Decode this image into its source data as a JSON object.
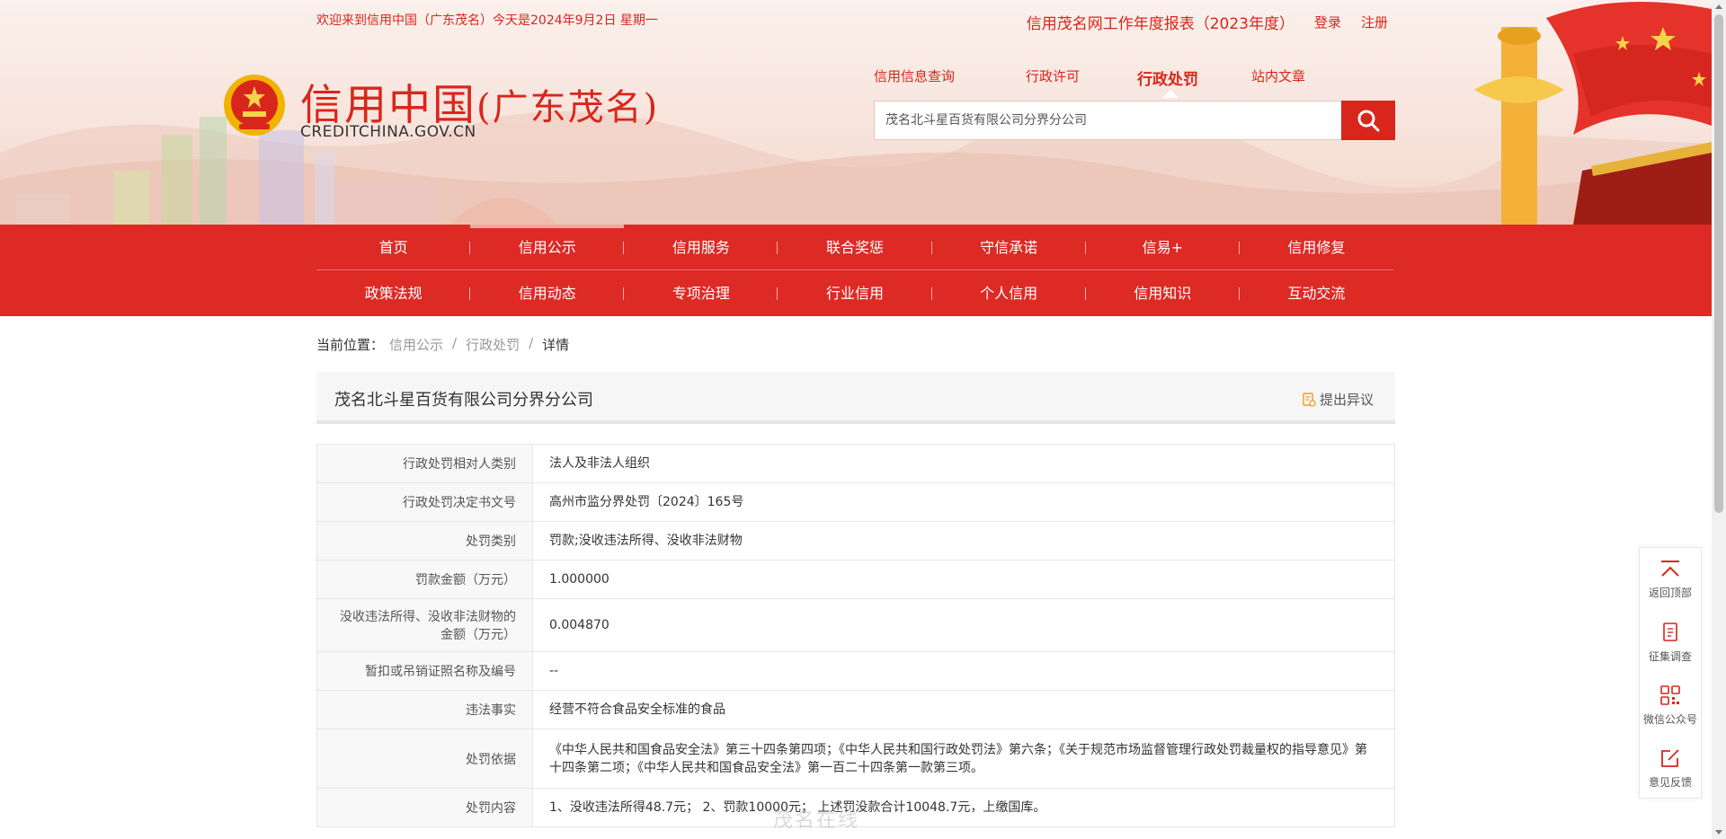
{
  "header": {
    "welcome": "欢迎来到信用中国（广东茂名）今天是2024年9月2日 星期一",
    "annual_report": "信用茂名网工作年度报表（2023年度）",
    "login": "登录",
    "register": "注册",
    "logo_cn_main": "信用中国",
    "logo_cn_region": "(广东茂名)",
    "logo_en": "CREDITCHINA.GOV.CN"
  },
  "search": {
    "tabs": [
      "信用信息查询",
      "行政许可",
      "行政处罚",
      "站内文章"
    ],
    "active_tab": "行政处罚",
    "value": "茂名北斗星百货有限公司分界分公司"
  },
  "nav": {
    "row1": [
      "首页",
      "信用公示",
      "信用服务",
      "联合奖惩",
      "守信承诺",
      "信易+",
      "信用修复"
    ],
    "row2": [
      "政策法规",
      "信用动态",
      "专项治理",
      "行业信用",
      "个人信用",
      "信用知识",
      "互动交流"
    ],
    "active": "信用公示"
  },
  "breadcrumb": {
    "prefix": "当前位置：",
    "items": [
      "信用公示",
      "行政处罚",
      "详情"
    ]
  },
  "detail": {
    "title": "茂名北斗星百货有限公司分界分公司",
    "objection": "提出异议",
    "rows": [
      {
        "key": "行政处罚相对人类别",
        "value": "法人及非法人组织"
      },
      {
        "key": "行政处罚决定书文号",
        "value": "高州市监分界处罚〔2024〕165号"
      },
      {
        "key": "处罚类别",
        "value": "罚款;没收违法所得、没收非法财物"
      },
      {
        "key": "罚款金额（万元）",
        "value": "1.000000"
      },
      {
        "key": "没收违法所得、没收非法财物的金额（万元）",
        "value": "0.004870"
      },
      {
        "key": "暂扣或吊销证照名称及编号",
        "value": "--"
      },
      {
        "key": "违法事实",
        "value": "经营不符合食品安全标准的食品"
      },
      {
        "key": "处罚依据",
        "value": "《中华人民共和国食品安全法》第三十四条第四项；《中华人民共和国行政处罚法》第六条；《关于规范市场监督管理行政处罚裁量权的指导意见》第十四条第二项；《中华人民共和国食品安全法》第一百二十四条第一款第三项。"
      },
      {
        "key": "处罚内容",
        "value": "1、没收违法所得48.7元； 2、罚款10000元； 上述罚没款合计10048.7元，上缴国库。"
      }
    ]
  },
  "float_bar": {
    "items": [
      "返回顶部",
      "征集调查",
      "微信公众号",
      "意见反馈"
    ]
  },
  "watermark": "茂名在线",
  "colors": {
    "brand_red": "#dd2a25",
    "text_red": "#d9261c",
    "accent_gold": "#f0b400"
  }
}
